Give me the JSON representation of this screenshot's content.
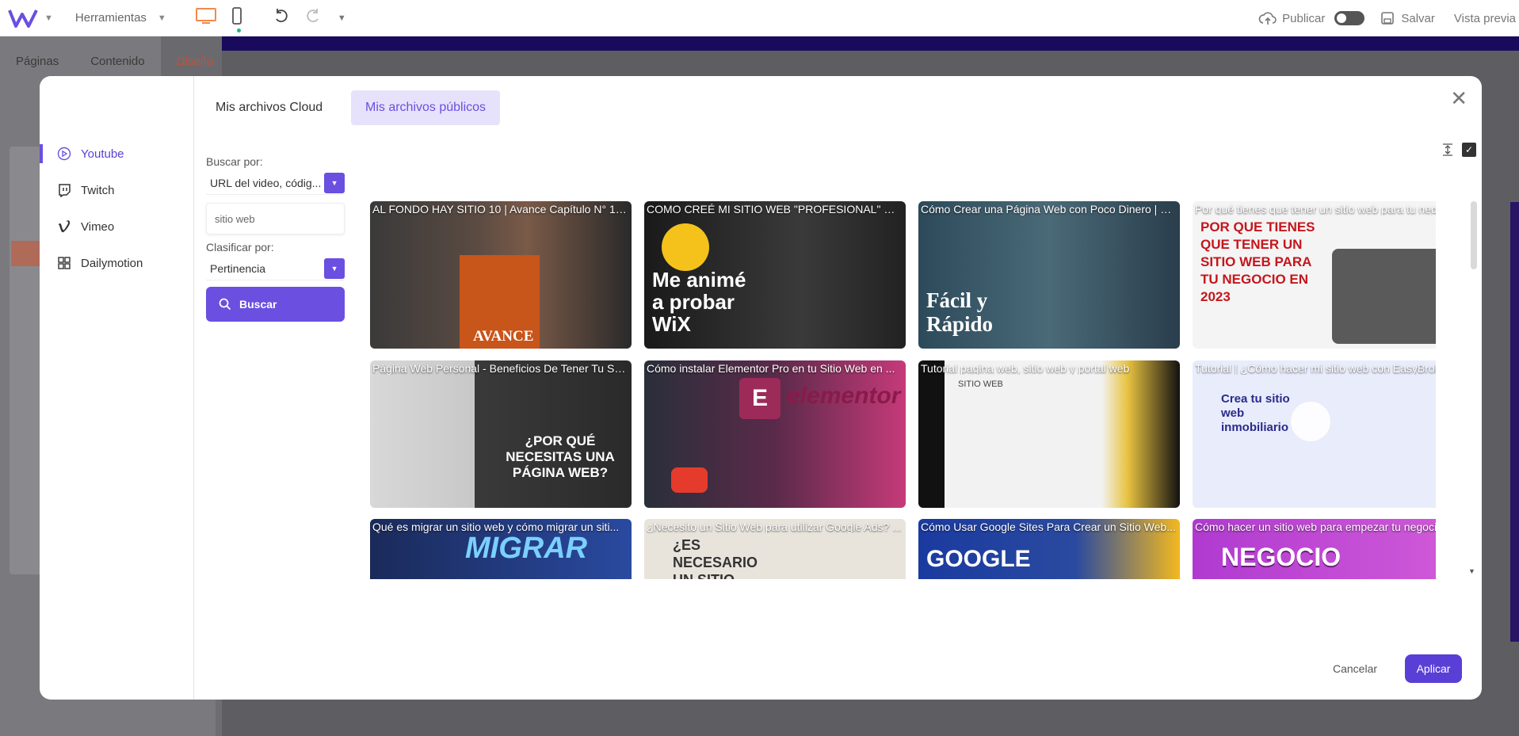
{
  "topbar": {
    "tools_label": "Herramientas",
    "publish_label": "Publicar",
    "save_label": "Salvar",
    "preview_label": "Vista previa"
  },
  "editor": {
    "tabs": [
      {
        "label": "Páginas"
      },
      {
        "label": "Contenido"
      },
      {
        "label": "Diseño"
      }
    ]
  },
  "modal": {
    "tabs": [
      {
        "label": "Mis archivos Cloud"
      },
      {
        "label": "Mis archivos públicos"
      }
    ],
    "sources": [
      {
        "label": "Youtube",
        "icon": "youtube-icon"
      },
      {
        "label": "Twitch",
        "icon": "twitch-icon"
      },
      {
        "label": "Vimeo",
        "icon": "vimeo-icon"
      },
      {
        "label": "Dailymotion",
        "icon": "dailymotion-icon"
      }
    ],
    "search_by_label": "Buscar por:",
    "search_by_value": "URL del video, códig...",
    "query_value": "sitio web",
    "sort_by_label": "Clasificar por:",
    "sort_by_value": "Pertinencia",
    "search_button": "Buscar",
    "cancel_label": "Cancelar",
    "apply_label": "Aplicar",
    "videos": [
      {
        "title": "AL FONDO HAY SITIO 10 | Avance Capítulo N° 17...",
        "thumb_text": "AVANCE"
      },
      {
        "title": "COMO CREÉ MI SITIO WEB \"PROFESIONAL\" EN ...",
        "thumb_text": "Me animé a probar WiX"
      },
      {
        "title": "Cómo Crear una Página Web con Poco Dinero | C...",
        "thumb_text": "Fácil y Rápido"
      },
      {
        "title": "Por qué tienes que tener un sitio web para tu neg...",
        "thumb_text": "POR QUE TIENES QUE TENER UN SITIO WEB PARA TU NEGOCIO EN 2023"
      },
      {
        "title": "Página Web Personal - Beneficios De Tener Tu Sit...",
        "thumb_text": "¿POR QUÉ NECESITAS UNA PÁGINA WEB?"
      },
      {
        "title": "Cómo instalar Elementor Pro en tu Sitio Web en ...",
        "thumb_text": "elementor"
      },
      {
        "title": "Tutorial pagina web, sitio web y portal web",
        "thumb_text": "SITIO WEB"
      },
      {
        "title": "Tutorial | ¿Cómo hacer mi sitio web con EasyBrok...",
        "thumb_text": "Crea tu sitio web inmobiliario"
      },
      {
        "title": "Qué es migrar un sitio web y cómo migrar un siti...",
        "thumb_text": "MIGRAR"
      },
      {
        "title": "¿Necesito un Sitio Web para utilizar Google Ads? ...",
        "thumb_text": "¿ES NECESARIO UN SITIO"
      },
      {
        "title": "Cómo Usar Google Sites Para Crear un Sitio Web...",
        "thumb_text": "GOOGLE"
      },
      {
        "title": "Cómo hacer un sitio web para empezar tu negoci...",
        "thumb_text": "NEGOCIO"
      }
    ]
  }
}
